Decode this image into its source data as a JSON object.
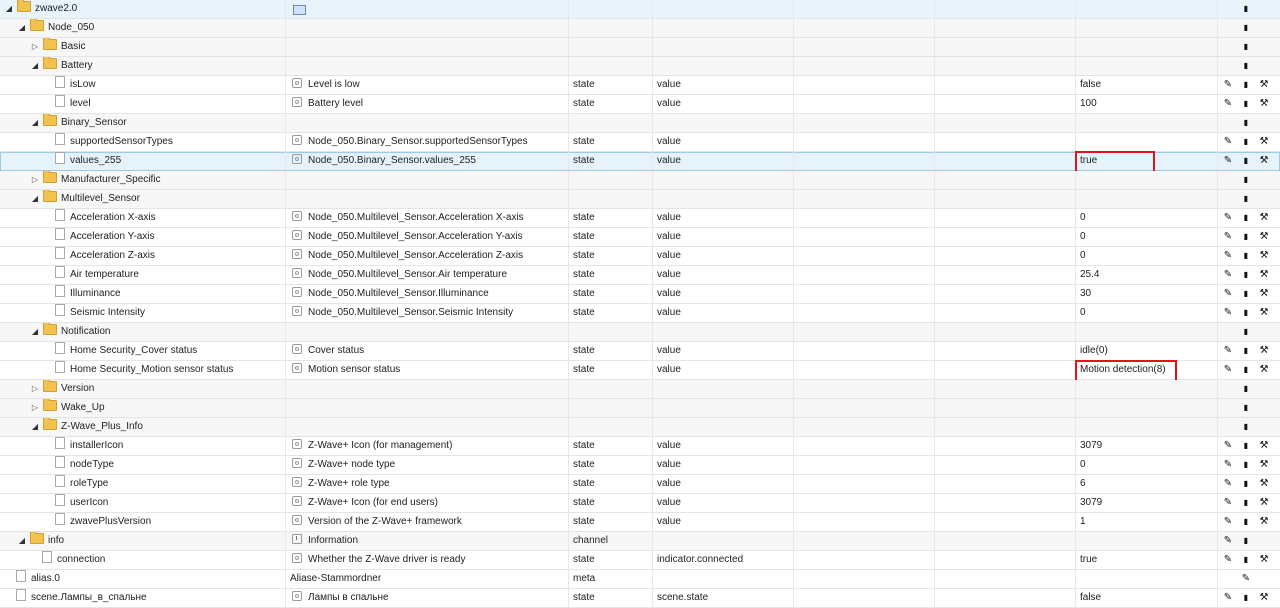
{
  "rows": [
    {
      "id": "zwave2.0",
      "name": "",
      "type": "",
      "role": "",
      "value": "",
      "kind": "folder",
      "indent": 0,
      "open": true,
      "nameIcon": "screen-icon",
      "actions": [
        "delete"
      ]
    },
    {
      "id": "Node_050",
      "name": "",
      "type": "",
      "role": "",
      "value": "",
      "kind": "folder",
      "indent": 1,
      "open": true,
      "nameIcon": "",
      "actions": [
        "delete"
      ]
    },
    {
      "id": "Basic",
      "name": "",
      "type": "",
      "role": "",
      "value": "",
      "kind": "folder",
      "indent": 2,
      "open": false,
      "nameIcon": "",
      "actions": [
        "delete"
      ]
    },
    {
      "id": "Battery",
      "name": "",
      "type": "",
      "role": "",
      "value": "",
      "kind": "folder",
      "indent": 2,
      "open": true,
      "nameIcon": "",
      "actions": [
        "delete"
      ]
    },
    {
      "id": "isLow",
      "name": "Level is low",
      "type": "state",
      "role": "value",
      "value": "false",
      "kind": "state",
      "indent": 3,
      "nameIcon": "state-icon",
      "actions": [
        "edit",
        "delete",
        "settings"
      ]
    },
    {
      "id": "level",
      "name": "Battery level",
      "type": "state",
      "role": "value",
      "value": "100",
      "kind": "state",
      "indent": 3,
      "nameIcon": "state-icon",
      "actions": [
        "edit",
        "delete",
        "settings"
      ]
    },
    {
      "id": "Binary_Sensor",
      "name": "",
      "type": "",
      "role": "",
      "value": "",
      "kind": "folder",
      "indent": 2,
      "open": true,
      "nameIcon": "",
      "actions": [
        "delete"
      ]
    },
    {
      "id": "supportedSensorTypes",
      "name": "Node_050.Binary_Sensor.supportedSensorTypes",
      "type": "state",
      "role": "value",
      "value": "",
      "kind": "state",
      "indent": 3,
      "nameIcon": "state-icon",
      "actions": [
        "edit",
        "delete",
        "settings"
      ]
    },
    {
      "id": "values_255",
      "name": "Node_050.Binary_Sensor.values_255",
      "type": "state",
      "role": "value",
      "value": "true",
      "kind": "state",
      "indent": 3,
      "nameIcon": "state-icon",
      "actions": [
        "edit",
        "delete",
        "settings"
      ],
      "selected": true
    },
    {
      "id": "Manufacturer_Specific",
      "name": "",
      "type": "",
      "role": "",
      "value": "",
      "kind": "folder",
      "indent": 2,
      "open": false,
      "nameIcon": "",
      "actions": [
        "delete"
      ]
    },
    {
      "id": "Multilevel_Sensor",
      "name": "",
      "type": "",
      "role": "",
      "value": "",
      "kind": "folder",
      "indent": 2,
      "open": true,
      "nameIcon": "",
      "actions": [
        "delete"
      ]
    },
    {
      "id": "Acceleration X-axis",
      "name": "Node_050.Multilevel_Sensor.Acceleration X-axis",
      "type": "state",
      "role": "value",
      "value": "0",
      "kind": "state",
      "indent": 3,
      "nameIcon": "state-icon",
      "actions": [
        "edit",
        "delete",
        "settings"
      ]
    },
    {
      "id": "Acceleration Y-axis",
      "name": "Node_050.Multilevel_Sensor.Acceleration Y-axis",
      "type": "state",
      "role": "value",
      "value": "0",
      "kind": "state",
      "indent": 3,
      "nameIcon": "state-icon",
      "actions": [
        "edit",
        "delete",
        "settings"
      ]
    },
    {
      "id": "Acceleration Z-axis",
      "name": "Node_050.Multilevel_Sensor.Acceleration Z-axis",
      "type": "state",
      "role": "value",
      "value": "0",
      "kind": "state",
      "indent": 3,
      "nameIcon": "state-icon",
      "actions": [
        "edit",
        "delete",
        "settings"
      ]
    },
    {
      "id": "Air temperature",
      "name": "Node_050.Multilevel_Sensor.Air temperature",
      "type": "state",
      "role": "value",
      "value": "25.4",
      "kind": "state",
      "indent": 3,
      "nameIcon": "state-icon",
      "actions": [
        "edit",
        "delete",
        "settings"
      ]
    },
    {
      "id": "Illuminance",
      "name": "Node_050.Multilevel_Sensor.Illuminance",
      "type": "state",
      "role": "value",
      "value": "30",
      "kind": "state",
      "indent": 3,
      "nameIcon": "state-icon",
      "actions": [
        "edit",
        "delete",
        "settings"
      ]
    },
    {
      "id": "Seismic Intensity",
      "name": "Node_050.Multilevel_Sensor.Seismic Intensity",
      "type": "state",
      "role": "value",
      "value": "0",
      "kind": "state",
      "indent": 3,
      "nameIcon": "state-icon",
      "actions": [
        "edit",
        "delete",
        "settings"
      ]
    },
    {
      "id": "Notification",
      "name": "",
      "type": "",
      "role": "",
      "value": "",
      "kind": "folder",
      "indent": 2,
      "open": true,
      "nameIcon": "",
      "actions": [
        "delete"
      ]
    },
    {
      "id": "Home Security_Cover status",
      "name": "Cover status",
      "type": "state",
      "role": "value",
      "value": "idle(0)",
      "kind": "state",
      "indent": 3,
      "nameIcon": "state-icon",
      "actions": [
        "edit",
        "delete",
        "settings"
      ]
    },
    {
      "id": "Home Security_Motion sensor status",
      "name": "Motion sensor status",
      "type": "state",
      "role": "value",
      "value": "Motion detection(8)",
      "kind": "state",
      "indent": 3,
      "nameIcon": "state-icon",
      "actions": [
        "edit",
        "delete",
        "settings"
      ]
    },
    {
      "id": "Version",
      "name": "",
      "type": "",
      "role": "",
      "value": "",
      "kind": "folder",
      "indent": 2,
      "open": false,
      "nameIcon": "",
      "actions": [
        "delete"
      ]
    },
    {
      "id": "Wake_Up",
      "name": "",
      "type": "",
      "role": "",
      "value": "",
      "kind": "folder",
      "indent": 2,
      "open": false,
      "nameIcon": "",
      "actions": [
        "delete"
      ]
    },
    {
      "id": "Z-Wave_Plus_Info",
      "name": "",
      "type": "",
      "role": "",
      "value": "",
      "kind": "folder",
      "indent": 2,
      "open": true,
      "nameIcon": "",
      "actions": [
        "delete"
      ]
    },
    {
      "id": "installerIcon",
      "name": "Z-Wave+ Icon (for management)",
      "type": "state",
      "role": "value",
      "value": "3079",
      "kind": "state",
      "indent": 3,
      "nameIcon": "state-icon",
      "actions": [
        "edit",
        "delete",
        "settings"
      ]
    },
    {
      "id": "nodeType",
      "name": "Z-Wave+ node type",
      "type": "state",
      "role": "value",
      "value": "0",
      "kind": "state",
      "indent": 3,
      "nameIcon": "state-icon",
      "actions": [
        "edit",
        "delete",
        "settings"
      ]
    },
    {
      "id": "roleType",
      "name": "Z-Wave+ role type",
      "type": "state",
      "role": "value",
      "value": "6",
      "kind": "state",
      "indent": 3,
      "nameIcon": "state-icon",
      "actions": [
        "edit",
        "delete",
        "settings"
      ]
    },
    {
      "id": "userIcon",
      "name": "Z-Wave+ Icon (for end users)",
      "type": "state",
      "role": "value",
      "value": "3079",
      "kind": "state",
      "indent": 3,
      "nameIcon": "state-icon",
      "actions": [
        "edit",
        "delete",
        "settings"
      ]
    },
    {
      "id": "zwavePlusVersion",
      "name": "Version of the Z-Wave+ framework",
      "type": "state",
      "role": "value",
      "value": "1",
      "kind": "state",
      "indent": 3,
      "nameIcon": "state-icon",
      "actions": [
        "edit",
        "delete",
        "settings"
      ]
    },
    {
      "id": "info",
      "name": "Information",
      "type": "channel",
      "role": "",
      "value": "",
      "kind": "folder",
      "indent": 1,
      "open": true,
      "nameIcon": "info-icon",
      "actions": [
        "edit",
        "delete"
      ]
    },
    {
      "id": "connection",
      "name": "Whether the Z-Wave driver is ready",
      "type": "state",
      "role": "indicator.connected",
      "value": "true",
      "kind": "state",
      "indent": 2,
      "nameIcon": "state-icon",
      "actions": [
        "edit",
        "delete",
        "settings"
      ]
    },
    {
      "id": "alias.0",
      "name": "Aliase-Stammordner",
      "type": "meta",
      "role": "",
      "value": "",
      "kind": "state",
      "indent": 0,
      "nameIcon": "",
      "actions": [
        "edit"
      ]
    },
    {
      "id": "scene.Лампы_в_спальне",
      "name": "Лампы в спальне",
      "type": "state",
      "role": "scene.state",
      "value": "false",
      "kind": "state",
      "indent": 0,
      "nameIcon": "state-icon",
      "actions": [
        "edit",
        "delete",
        "settings"
      ]
    }
  ],
  "highlights": [
    "values_255",
    "Home Security_Motion sensor status"
  ],
  "icons": {
    "edit": "pencil-icon",
    "delete": "trash-icon",
    "settings": "wrench-icon"
  },
  "colors": {
    "highlight": "#e0141b",
    "selection": "#e6f3fb"
  }
}
